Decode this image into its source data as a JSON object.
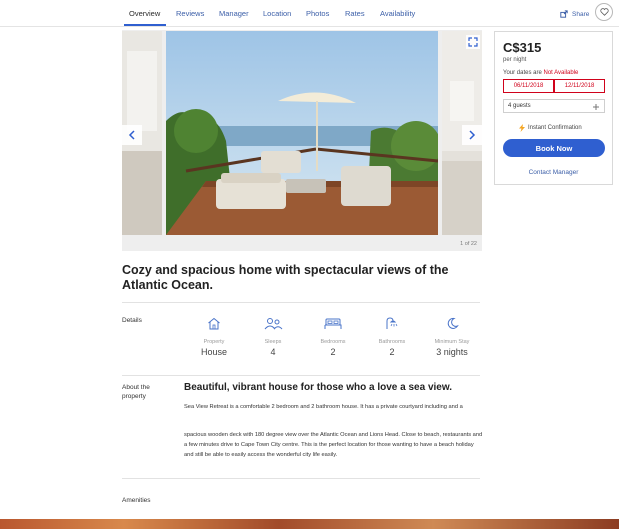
{
  "nav": {
    "tabs": [
      {
        "label": "Overview",
        "active": true
      },
      {
        "label": "Reviews"
      },
      {
        "label": "Manager"
      },
      {
        "label": "Location"
      },
      {
        "label": "Photos"
      },
      {
        "label": "Rates"
      },
      {
        "label": "Availability"
      }
    ],
    "share_label": "Share"
  },
  "gallery": {
    "counter": "1 of 22"
  },
  "booking": {
    "price": "C$315",
    "per_night": "per night",
    "dates_prefix": "Your dates are",
    "dates_status": "Not Available",
    "check_in": "06/11/2018",
    "check_out": "12/11/2018",
    "guests": "4 guests",
    "instant_label": "Instant Confirmation",
    "book_label": "Book Now",
    "contact_label": "Contact Manager"
  },
  "listing": {
    "title": "Cozy and spacious home with spectacular views of the Atlantic Ocean."
  },
  "details": {
    "label": "Details",
    "items": [
      {
        "icon": "house-icon",
        "label": "Property",
        "value": "House"
      },
      {
        "icon": "people-icon",
        "label": "Sleeps",
        "value": "4"
      },
      {
        "icon": "bed-icon",
        "label": "Bedrooms",
        "value": "2"
      },
      {
        "icon": "shower-icon",
        "label": "Bathrooms",
        "value": "2"
      },
      {
        "icon": "moon-icon",
        "label": "Minimum Stay",
        "value": "3 nights"
      }
    ]
  },
  "about": {
    "label": "About the property",
    "heading": "Beautiful, vibrant house for those who a love a sea view.",
    "para1": "Sea View Retreat is a comfortable 2 bedroom and 2 bathroom house. It has a private courtyard including and a",
    "para2": "spacious wooden deck with 180 degree view over the Atlantic Ocean and Lions Head. Close to beach, restaurants and a few minutes drive to Cape Town City centre. This is the perfect location for those wanting to have a beach holiday and still be able to easily access the wonderful city life easily."
  },
  "amenities": {
    "label": "Amenities"
  },
  "colors": {
    "accent": "#2f5fd0",
    "link": "#3c5fa8",
    "error": "#d0021b"
  }
}
